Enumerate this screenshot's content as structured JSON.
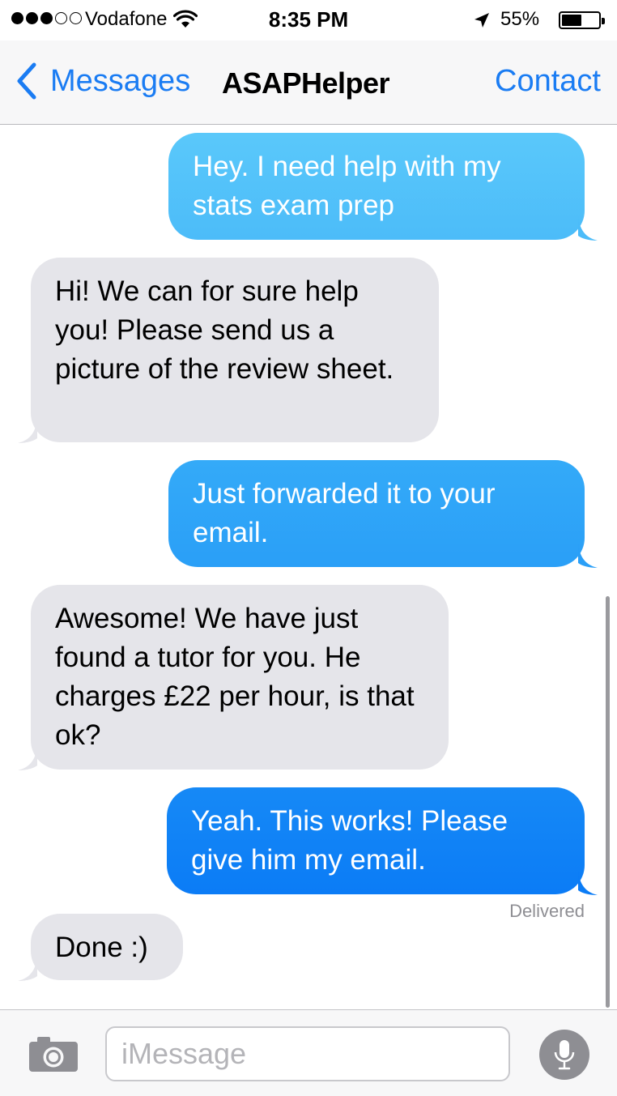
{
  "status_bar": {
    "carrier": "Vodafone",
    "time": "8:35 PM",
    "battery_percent_text": "55%",
    "battery_level": 0.55,
    "signal_bars_filled": 3,
    "signal_bars_total": 5
  },
  "nav": {
    "back_label": "Messages",
    "title": "ASAPHelper",
    "contact_label": "Contact"
  },
  "messages": [
    {
      "direction": "outgoing",
      "text": "Hey. I need help with my stats exam prep"
    },
    {
      "direction": "incoming",
      "text": "Hi! We can for sure help you! Please send us a picture of the review sheet."
    },
    {
      "direction": "outgoing",
      "text": "Just forwarded it to your email."
    },
    {
      "direction": "incoming",
      "text": "Awesome! We have just found a tutor for you. He charges £22 per hour, is that ok?"
    },
    {
      "direction": "outgoing",
      "text": "Yeah. This works! Please give him my email."
    },
    {
      "direction": "incoming",
      "text": "Done :)"
    }
  ],
  "delivery_status": "Delivered",
  "input": {
    "placeholder": "iMessage",
    "value": ""
  },
  "colors": {
    "accent": "#1a7cf3",
    "incoming_bubble": "#e5e5ea",
    "outgoing_gradient_top": "#5ac8fa",
    "outgoing_gradient_bottom": "#0b7cf6"
  },
  "icons": {
    "back": "chevron-left-icon",
    "camera": "camera-icon",
    "mic": "microphone-icon",
    "wifi": "wifi-icon",
    "location": "location-arrow-icon",
    "battery": "battery-icon"
  }
}
